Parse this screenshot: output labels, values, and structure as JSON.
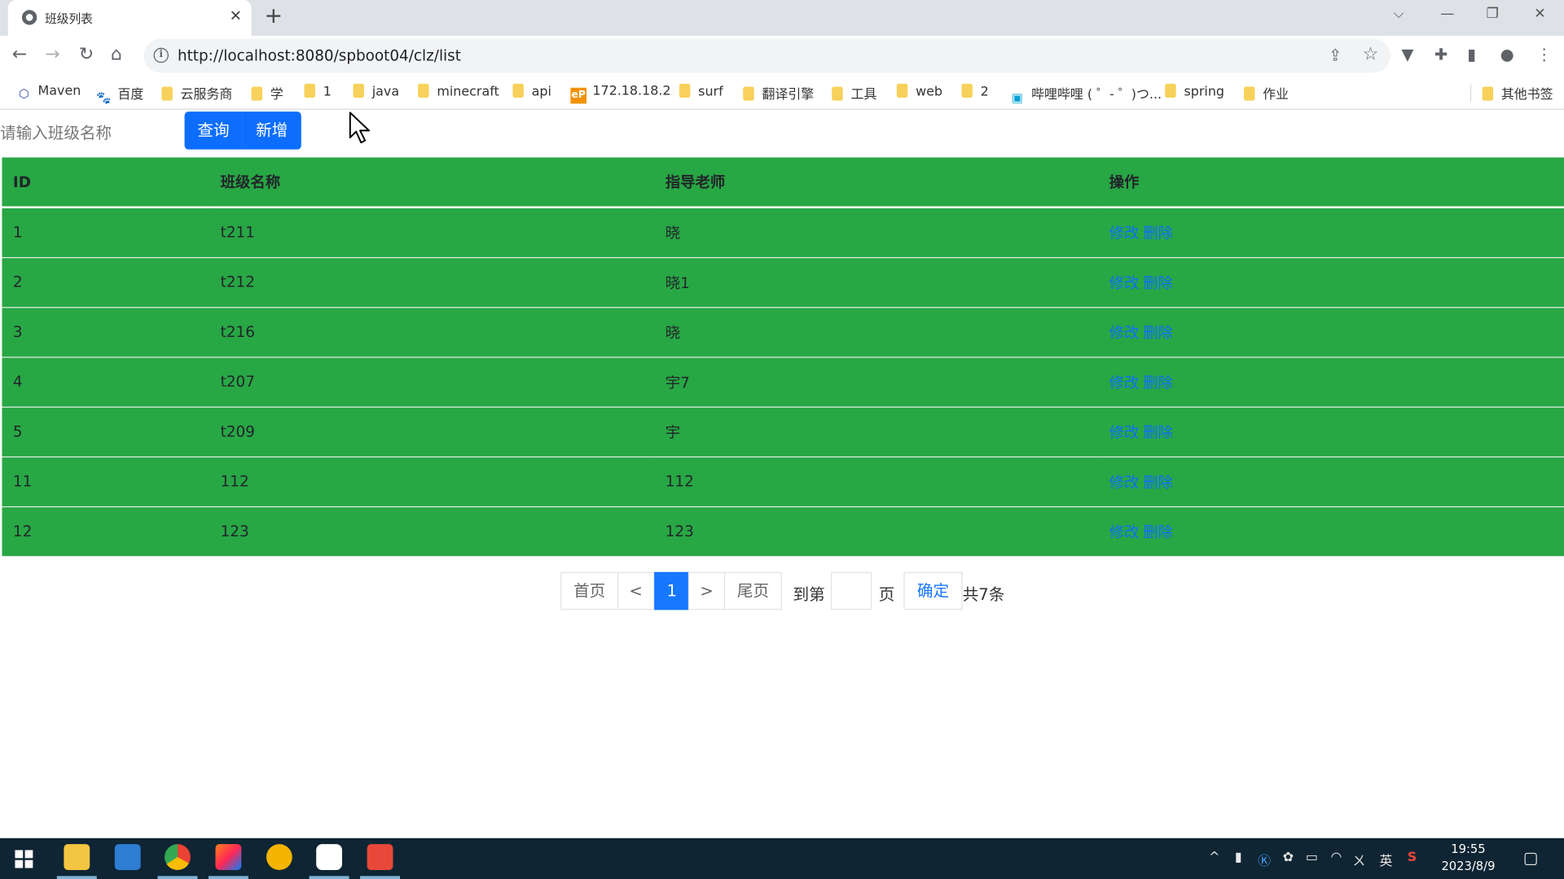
{
  "browser": {
    "tab_title": "班级列表",
    "tab_close": "✕",
    "new_tab": "+",
    "url": "http://localhost:8080/spboot04/clz/list",
    "window_controls": {
      "dropdown": "⌵",
      "minimize": "—",
      "restore": "❐",
      "close": "✕"
    },
    "nav": {
      "back": "←",
      "forward": "→",
      "reload": "↻",
      "home": "⌂"
    }
  },
  "bookmarks": [
    {
      "label": "Maven",
      "icon": "maven-icon"
    },
    {
      "label": "百度",
      "icon": "baidu-icon"
    },
    {
      "label": "云服务商",
      "icon": "folder"
    },
    {
      "label": "学",
      "icon": "folder"
    },
    {
      "label": "1",
      "icon": "folder"
    },
    {
      "label": "java",
      "icon": "folder"
    },
    {
      "label": "minecraft",
      "icon": "folder"
    },
    {
      "label": "api",
      "icon": "folder"
    },
    {
      "label": "172.18.18.2",
      "icon": "ep-icon"
    },
    {
      "label": "surf",
      "icon": "folder"
    },
    {
      "label": "翻译引擎",
      "icon": "folder"
    },
    {
      "label": "工具",
      "icon": "folder"
    },
    {
      "label": "web",
      "icon": "folder"
    },
    {
      "label": "2",
      "icon": "folder"
    },
    {
      "label": "哔哩哔哩 ( ゜- ゜)つ...",
      "icon": "bilibili-icon"
    },
    {
      "label": "spring",
      "icon": "folder"
    },
    {
      "label": "作业",
      "icon": "folder"
    }
  ],
  "other_bookmarks": "其他书签",
  "search": {
    "placeholder": "请输入班级名称",
    "value": ""
  },
  "buttons": {
    "query": "查询",
    "add": "新增"
  },
  "table": {
    "headers": [
      "ID",
      "班级名称",
      "指导老师",
      "操作"
    ],
    "rows": [
      {
        "id": "1",
        "name": "t211",
        "teacher": "晓"
      },
      {
        "id": "2",
        "name": "t212",
        "teacher": "晓1"
      },
      {
        "id": "3",
        "name": "t216",
        "teacher": "晓"
      },
      {
        "id": "4",
        "name": "t207",
        "teacher": "宇7"
      },
      {
        "id": "5",
        "name": "t209",
        "teacher": "宇"
      },
      {
        "id": "11",
        "name": "112",
        "teacher": "112"
      },
      {
        "id": "12",
        "name": "123",
        "teacher": "123"
      }
    ],
    "edit_label": "修改",
    "delete_label": "删除",
    "row_color": "#28a745",
    "link_color": "#0d6efd"
  },
  "pager": {
    "first": "首页",
    "prev": "<",
    "current": "1",
    "next": ">",
    "last": "尾页",
    "goto_prefix": "到第",
    "goto_value": "",
    "goto_suffix": "页",
    "confirm": "确定",
    "total": "共7条"
  },
  "taskbar": {
    "time": "19:55",
    "date": "2023/8/9",
    "ime": "英",
    "mute": "ㄨ"
  }
}
